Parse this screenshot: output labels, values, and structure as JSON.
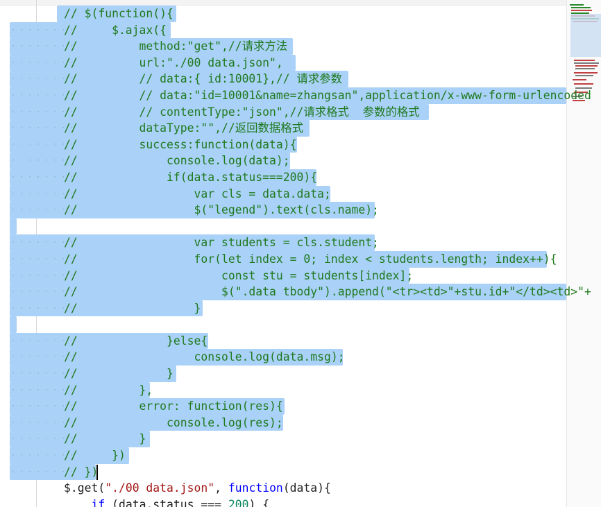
{
  "editor": {
    "lines": [
      {
        "text": "// $(function(){",
        "sel_right": 254,
        "dots": false
      },
      {
        "text": "//     $.ajax({",
        "sel_right": 246,
        "dots": true
      },
      {
        "text": "//         method:\"get\",//请求方法",
        "sel_right": 422,
        "dots": true
      },
      {
        "text": "//         url:\"./00 data.json\",",
        "sel_right": 426,
        "dots": true
      },
      {
        "text": "//         // data:{ id:10001},// 请求参数",
        "sel_right": 502,
        "dots": true
      },
      {
        "text": "//         // data:\"id=10001&name=zhangsan\",application/x-www-form-urlencoded",
        "sel_right": 816,
        "dots": true
      },
      {
        "text": "//         // contentType:\"json\",//请求格式  参数的格式",
        "sel_right": 618,
        "dots": true
      },
      {
        "text": "//         dataType:\"\",//返回数据格式",
        "sel_right": 446,
        "dots": true
      },
      {
        "text": "//         success:function(data){",
        "sel_right": 428,
        "dots": true
      },
      {
        "text": "//             console.log(data);",
        "sel_right": 418,
        "dots": true
      },
      {
        "text": "//             if(data.status===200){",
        "sel_right": 456,
        "dots": true
      },
      {
        "text": "//                 var cls = data.data;",
        "sel_right": 476,
        "dots": true
      },
      {
        "text": "//                 $(\"legend\").text(cls.name);",
        "sel_right": 540,
        "dots": true
      },
      {
        "text": "",
        "sel_right": 24,
        "dots": false
      },
      {
        "text": "//                 var students = cls.student;",
        "sel_right": 540,
        "dots": true
      },
      {
        "text": "//                 for(let index = 0; index < students.length; index++){",
        "sel_right": 788,
        "dots": true
      },
      {
        "text": "//                     const stu = students[index];",
        "sel_right": 590,
        "dots": true
      },
      {
        "text": "//                     $(\".data tbody\").append(\"<tr><td>\"+stu.id+\"</td><td>\"+",
        "sel_right": 816,
        "dots": true
      },
      {
        "text": "//                 }",
        "sel_right": 292,
        "dots": true
      },
      {
        "text": "",
        "sel_right": 24,
        "dots": false
      },
      {
        "text": "//             }else{",
        "sel_right": 300,
        "dots": true
      },
      {
        "text": "//                 console.log(data.msg);",
        "sel_right": 494,
        "dots": true
      },
      {
        "text": "//             }",
        "sel_right": 254,
        "dots": true
      },
      {
        "text": "//         },",
        "sel_right": 216,
        "dots": true
      },
      {
        "text": "//         error: function(res){",
        "sel_right": 410,
        "dots": true
      },
      {
        "text": "//             console.log(res);",
        "sel_right": 408,
        "dots": true
      },
      {
        "text": "//         }",
        "sel_right": 216,
        "dots": true
      },
      {
        "text": "//     })",
        "sel_right": 186,
        "dots": true
      },
      {
        "text": "// })",
        "sel_right": 138,
        "dots": true
      },
      {
        "text": "$.get(\"./00 data.json\", function(data){",
        "sel_right": 0,
        "dots": false
      },
      {
        "text": "    if (data.status === 200) {",
        "sel_right": 0,
        "dots": false
      }
    ],
    "cursor_line": 28,
    "colors": {
      "selection": "#aad1f7",
      "comment": "#1f7a1f",
      "keyword": "#0000ff",
      "string": "#a31515",
      "function": "#795e26"
    }
  }
}
